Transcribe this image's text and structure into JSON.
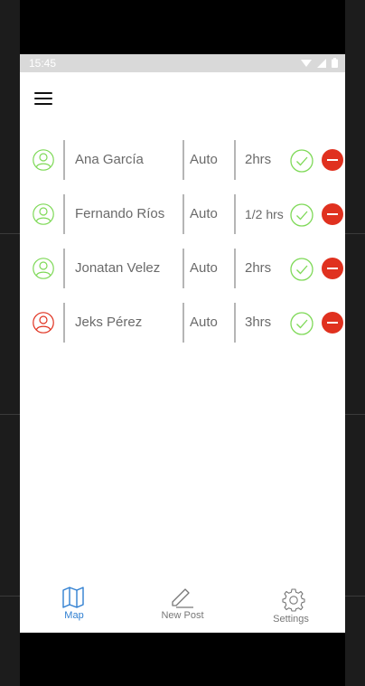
{
  "status_bar": {
    "time": "15:45"
  },
  "rows": [
    {
      "name": "Ana García",
      "type": "Auto",
      "time": "2hrs",
      "avatar_color": "#7ed957"
    },
    {
      "name": "Fernando Ríos",
      "type": "Auto",
      "time": "1/2 hrs",
      "avatar_color": "#7ed957"
    },
    {
      "name": "Jonatan Velez",
      "type": "Auto",
      "time": "2hrs",
      "avatar_color": "#7ed957"
    },
    {
      "name": "Jeks Pérez",
      "type": "Auto",
      "time": "3hrs",
      "avatar_color": "#e0311f"
    }
  ],
  "tabs": [
    {
      "label": "Map",
      "icon": "map-icon",
      "active": true
    },
    {
      "label": "New Post",
      "icon": "pencil-icon",
      "active": false
    },
    {
      "label": "Settings",
      "icon": "gear-icon",
      "active": false
    }
  ],
  "colors": {
    "accept": "#7ed957",
    "remove": "#e0311f",
    "active_tab": "#2f7fd1"
  }
}
